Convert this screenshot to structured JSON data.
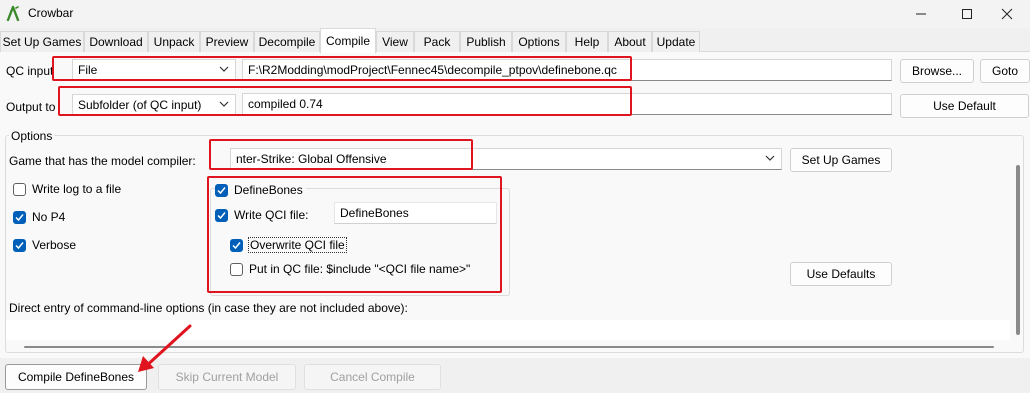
{
  "window": {
    "title": "Crowbar",
    "icon": "crowbar-app-icon"
  },
  "tabs": [
    {
      "label": "Set Up Games"
    },
    {
      "label": "Download"
    },
    {
      "label": "Unpack"
    },
    {
      "label": "Preview"
    },
    {
      "label": "Decompile"
    },
    {
      "label": "Compile"
    },
    {
      "label": "View"
    },
    {
      "label": "Pack"
    },
    {
      "label": "Publish"
    },
    {
      "label": "Options"
    },
    {
      "label": "Help"
    },
    {
      "label": "About"
    },
    {
      "label": "Update"
    }
  ],
  "active_tab": "Compile",
  "qc_input": {
    "label": "QC input",
    "mode": "File",
    "path": "F:\\R2Modding\\modProject\\Fennec45\\decompile_ptpov\\definebone.qc",
    "browse_label": "Browse...",
    "goto_label": "Goto"
  },
  "output_to": {
    "label": "Output to",
    "mode": "Subfolder (of QC input)",
    "value": "compiled 0.74",
    "use_default_label": "Use Default"
  },
  "options": {
    "group_label": "Options",
    "game_label": "Game that has the model compiler:",
    "game_value": "nter-Strike: Global Offensive",
    "set_up_games_label": "Set Up Games",
    "write_log_label": "Write log to a file",
    "write_log": false,
    "no_p4_label": "No P4",
    "no_p4": true,
    "verbose_label": "Verbose",
    "verbose": true,
    "define_bones_label": "DefineBones",
    "define_bones": true,
    "write_qci_label": "Write QCI file:",
    "write_qci": true,
    "qci_name": "DefineBones",
    "overwrite_qci_label": "Overwrite QCI file",
    "overwrite_qci": true,
    "put_in_qc_label": "Put in QC file: $include \"<QCI file name>\"",
    "put_in_qc": false,
    "use_defaults_label": "Use Defaults",
    "direct_entry_label": "Direct entry of command-line options (in case they are not included above):",
    "direct_entry_value": ""
  },
  "bottom_buttons": {
    "compile_label": "Compile DefineBones",
    "skip_label": "Skip Current Model",
    "cancel_label": "Cancel Compile"
  },
  "colors": {
    "highlight": "#e0141e",
    "checkbox_checked": "#005fb8",
    "panel_bg": "#f9f9f9"
  }
}
